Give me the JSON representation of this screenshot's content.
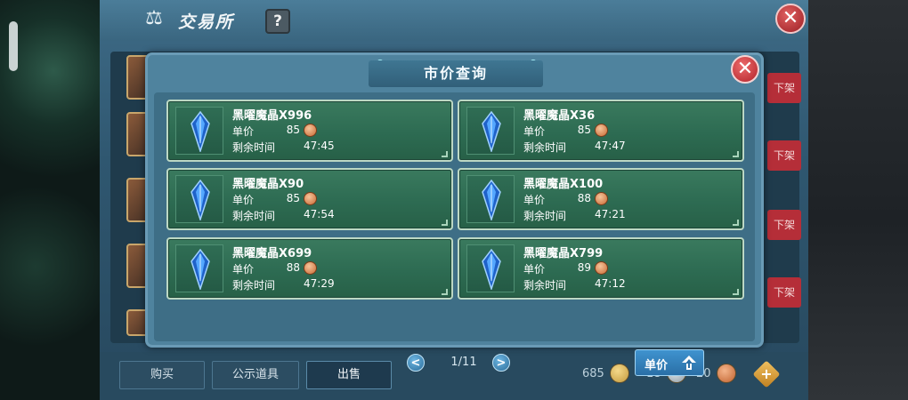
{
  "exchange": {
    "title": "交易所",
    "help_label": "?",
    "close_label": "✕",
    "list_delist_label": "下架",
    "tabs": [
      {
        "label": "购买"
      },
      {
        "label": "公示道具"
      },
      {
        "label": "出售"
      }
    ],
    "active_tab": "出售",
    "currencies": [
      {
        "type": "gold",
        "value": "685"
      },
      {
        "type": "silver",
        "value": "18"
      },
      {
        "type": "copper",
        "value": "20"
      }
    ]
  },
  "dialog": {
    "title": "市价查询",
    "close_label": "✕",
    "price_label": "单价",
    "time_label": "剩余时间",
    "items": [
      {
        "name": "黑曜魔晶X996",
        "price": "85",
        "time": "47:45"
      },
      {
        "name": "黑曜魔晶X36",
        "price": "85",
        "time": "47:47"
      },
      {
        "name": "黑曜魔晶X90",
        "price": "85",
        "time": "47:54"
      },
      {
        "name": "黑曜魔晶X100",
        "price": "88",
        "time": "47:21"
      },
      {
        "name": "黑曜魔晶X699",
        "price": "88",
        "time": "47:29"
      },
      {
        "name": "黑曜魔晶X799",
        "price": "89",
        "time": "47:12"
      }
    ],
    "pager": {
      "text": "1/11",
      "prev": "<",
      "next": ">"
    },
    "sort_label": "单价"
  },
  "colors": {
    "card_green": "#2d6b52",
    "dialog_blue": "#4f839e",
    "close_red": "#b3222a",
    "crystal_blue": "#2f7fe0"
  }
}
